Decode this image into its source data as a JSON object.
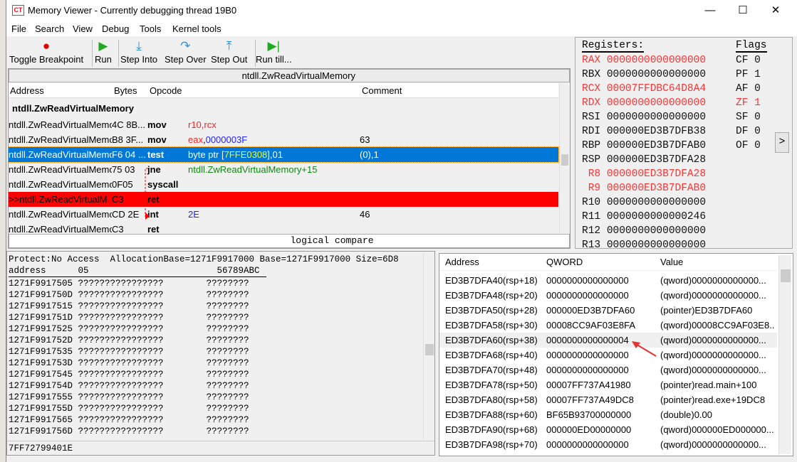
{
  "window": {
    "title": "Memory Viewer - Currently debugging thread 19B0",
    "minimize": "—",
    "maximize": "☐",
    "close": "✕"
  },
  "menu": [
    "File",
    "Search",
    "View",
    "Debug",
    "Tools",
    "Kernel tools"
  ],
  "toolbar": [
    {
      "label": "Toggle Breakpoint",
      "icon": "●",
      "color": "#e00000"
    },
    {
      "label": "Run",
      "icon": "▶",
      "color": "#22aa22"
    },
    {
      "label": "Step Into",
      "icon": "⤓",
      "color": "#3090e0"
    },
    {
      "label": "Step Over",
      "icon": "↷",
      "color": "#3090e0"
    },
    {
      "label": "Step Out",
      "icon": "⤒",
      "color": "#3090e0"
    },
    {
      "label": "Run till...",
      "icon": "▶|",
      "color": "#22aa22"
    }
  ],
  "disasm": {
    "function_bar": "ntdll.ZwReadVirtualMemory",
    "headers": {
      "address": "Address",
      "bytes": "Bytes",
      "opcode": "Opcode",
      "comment": "Comment"
    },
    "section_title": "ntdll.ZwReadVirtualMemory",
    "rows": [
      {
        "address": "ntdll.ZwReadVirtualMemory",
        "bytes": "4C 8B...",
        "op": "mov",
        "args": "r10,rcx",
        "comment": ""
      },
      {
        "address": "ntdll.ZwReadVirtualMemory",
        "bytes": "B8 3F...",
        "op": "mov",
        "args": "eax,0000003F",
        "comment": "63"
      },
      {
        "address": "ntdll.ZwReadVirtualMemory",
        "bytes": "F6 04 ...",
        "op": "test",
        "args": "byte ptr [7FFE0308],01",
        "comment": "(0),1"
      },
      {
        "address": "ntdll.ZwReadVirtualMemory",
        "bytes": "75 03",
        "op": "jne",
        "args": "ntdll.ZwReadVirtualMemory+15",
        "comment": ""
      },
      {
        "address": "ntdll.ZwReadVirtualMemory",
        "bytes": "0F05",
        "op": "syscall",
        "args": "",
        "comment": ""
      },
      {
        "address": ">>ntdll.ZwReadVirtualM",
        "bytes": "C3",
        "op": "ret",
        "args": "",
        "comment": ""
      },
      {
        "address": "ntdll.ZwReadVirtualMemory",
        "bytes": "CD 2E",
        "op": "int",
        "args": "2E",
        "comment": "46"
      },
      {
        "address": "ntdll.ZwReadVirtualMemory",
        "bytes": "C3",
        "op": "ret",
        "args": "",
        "comment": ""
      }
    ],
    "status": "logical compare"
  },
  "registers": {
    "title": "Registers:",
    "flags_title": "Flags",
    "list": [
      {
        "name": "RAX",
        "value": "0000000000000000",
        "changed": true
      },
      {
        "name": "RBX",
        "value": "0000000000000000",
        "changed": false
      },
      {
        "name": "RCX",
        "value": "00007FFDBC64D8A4",
        "changed": true
      },
      {
        "name": "RDX",
        "value": "0000000000000000",
        "changed": true
      },
      {
        "name": "RSI",
        "value": "0000000000000000",
        "changed": false
      },
      {
        "name": "RDI",
        "value": "000000ED3B7DFB38",
        "changed": false
      },
      {
        "name": "RBP",
        "value": "000000ED3B7DFAB0",
        "changed": false
      },
      {
        "name": "RSP",
        "value": "000000ED3B7DFA28",
        "changed": false
      },
      {
        "name": " R8",
        "value": "000000ED3B7DFA28",
        "changed": true
      },
      {
        "name": " R9",
        "value": "000000ED3B7DFAB0",
        "changed": true
      },
      {
        "name": "R10",
        "value": "0000000000000000",
        "changed": false
      },
      {
        "name": "R11",
        "value": "0000000000000246",
        "changed": false
      },
      {
        "name": "R12",
        "value": "0000000000000000",
        "changed": false
      },
      {
        "name": "R13",
        "value": "0000000000000000",
        "changed": false
      }
    ],
    "flags": [
      {
        "name": "CF",
        "value": "0",
        "changed": false
      },
      {
        "name": "PF",
        "value": "1",
        "changed": false
      },
      {
        "name": "AF",
        "value": "0",
        "changed": false
      },
      {
        "name": "ZF",
        "value": "1",
        "changed": true
      },
      {
        "name": "SF",
        "value": "0",
        "changed": false
      },
      {
        "name": "DF",
        "value": "0",
        "changed": false
      },
      {
        "name": "OF",
        "value": "0",
        "changed": false
      }
    ],
    "expand": ">"
  },
  "hex": {
    "info": "Protect:No Access  AllocationBase=1271F9917000 Base=1271F9917000 Size=6D8",
    "header": "address      05                        56789ABC",
    "rows": [
      "1271F9917505",
      "1271F991750D",
      "1271F9917515",
      "1271F991751D",
      "1271F9917525",
      "1271F991752D",
      "1271F9917535",
      "1271F991753D",
      "1271F9917545",
      "1271F991754D",
      "1271F9917555",
      "1271F991755D",
      "1271F9917565",
      "1271F991756D"
    ],
    "bytes": "????????????????",
    "ascii": "????????",
    "address_field": "7FF72799401E"
  },
  "stack": {
    "headers": {
      "address": "Address",
      "qword": "QWORD",
      "value": "Value"
    },
    "rows": [
      {
        "address": "ED3B7DFA40(rsp+18)",
        "qword": "0000000000000000",
        "value": "(qword)0000000000000..."
      },
      {
        "address": "ED3B7DFA48(rsp+20)",
        "qword": "0000000000000000",
        "value": "(qword)0000000000000..."
      },
      {
        "address": "ED3B7DFA50(rsp+28)",
        "qword": "000000ED3B7DFA60",
        "value": "(pointer)ED3B7DFA60"
      },
      {
        "address": "ED3B7DFA58(rsp+30)",
        "qword": "00008CC9AF03E8FA",
        "value": "(qword)00008CC9AF03E8..."
      },
      {
        "address": "ED3B7DFA60(rsp+38)",
        "qword": "0000000000000004",
        "value": "(qword)0000000000000..."
      },
      {
        "address": "ED3B7DFA68(rsp+40)",
        "qword": "0000000000000000",
        "value": "(qword)0000000000000..."
      },
      {
        "address": "ED3B7DFA70(rsp+48)",
        "qword": "0000000000000000",
        "value": "(qword)0000000000000..."
      },
      {
        "address": "ED3B7DFA78(rsp+50)",
        "qword": "00007FF737A41980",
        "value": "(pointer)read.main+100"
      },
      {
        "address": "ED3B7DFA80(rsp+58)",
        "qword": "00007FF737A49DC8",
        "value": "(pointer)read.exe+19DC8"
      },
      {
        "address": "ED3B7DFA88(rsp+60)",
        "qword": "BF65B93700000000",
        "value": "(double)0.00"
      },
      {
        "address": "ED3B7DFA90(rsp+68)",
        "qword": "000000ED00000000",
        "value": "(qword)000000ED000000..."
      },
      {
        "address": "ED3B7DFA98(rsp+70)",
        "qword": "0000000000000000",
        "value": "(qword)0000000000000..."
      }
    ]
  },
  "colors": {
    "selection": "#0078d7",
    "current_ip": "#ff0000",
    "changed_register": "#ff3333",
    "arrow_annotation": "#e83030"
  }
}
